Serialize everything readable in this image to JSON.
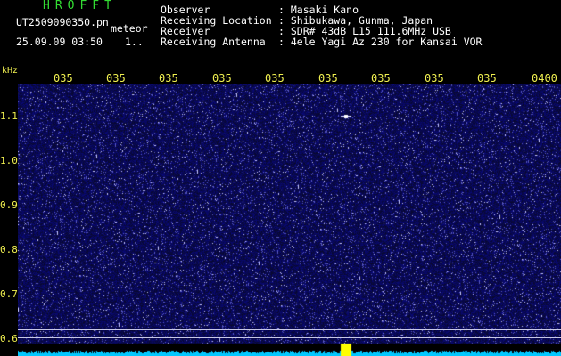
{
  "header": {
    "app_title": "HROFFT",
    "filename": "UT2509090350.pn",
    "mode": "meteor",
    "datetime": "25.09.09 03:50",
    "count": "1..",
    "info": [
      {
        "label": "Observer",
        "value": ": Masaki Kano"
      },
      {
        "label": "Receiving Location",
        "value": ": Shibukawa, Gunma, Japan"
      },
      {
        "label": "Receiver",
        "value": ": SDR# 43dB L15 111.6MHz USB"
      },
      {
        "label": "Receiving Antenna",
        "value": ": 4ele Yagi Az 230 for Kansai VOR"
      }
    ]
  },
  "axis": {
    "unit": "kHz",
    "time_ticks": [
      "035",
      "035",
      "035",
      "035",
      "035",
      "035",
      "035",
      "035",
      "035",
      "0400"
    ],
    "freq_ticks": [
      "1.1",
      "1.0",
      "0.9",
      "0.8",
      "0.7",
      "0.6"
    ]
  },
  "colors": {
    "background": "#000000",
    "waterfall": "#1a1a70",
    "header_title": "#33dd33",
    "axis_labels": "#f0f050",
    "spectrum": "#00c8ff",
    "meteor_echo": "#ffff00"
  }
}
